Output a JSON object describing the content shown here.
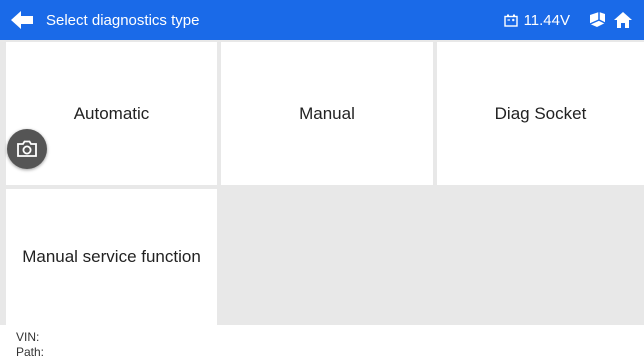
{
  "header": {
    "title": "Select diagnostics type",
    "voltage": "11.44V",
    "bg_color": "#1a6ae8",
    "icons": [
      "back-arrow-icon",
      "battery-icon",
      "vehicle-icon",
      "home-icon"
    ]
  },
  "tiles": [
    {
      "label": "Automatic"
    },
    {
      "label": "Manual"
    },
    {
      "label": "Diag Socket"
    },
    {
      "label": "Manual service function"
    }
  ],
  "floating": {
    "icon": "camera-icon"
  },
  "footer": {
    "vin_label": "VIN:",
    "path_label": "Path:"
  }
}
